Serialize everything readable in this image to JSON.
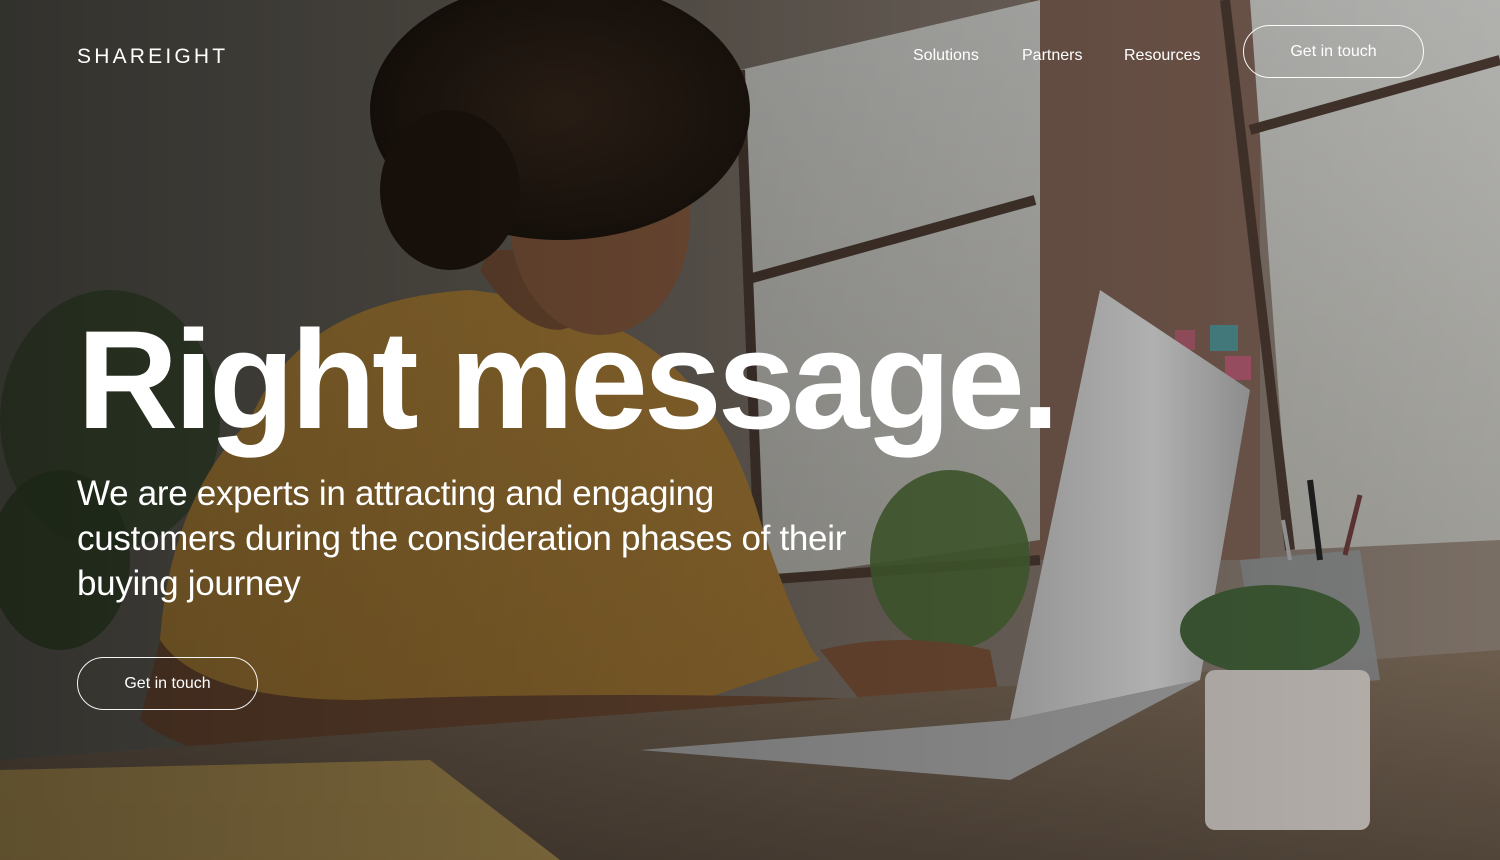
{
  "header": {
    "logo": "SHAREIGHT",
    "nav": [
      {
        "label": "Solutions"
      },
      {
        "label": "Partners"
      },
      {
        "label": "Resources"
      }
    ],
    "cta_label": "Get in touch"
  },
  "hero": {
    "headline": "Right message.",
    "subheadline": "We are experts in attracting and engaging customers during the consideration phases of their buying journey",
    "cta_label": "Get in touch"
  },
  "colors": {
    "text": "#ffffff",
    "shirt": "#c9973e",
    "laptop": "#d9d9d9"
  }
}
